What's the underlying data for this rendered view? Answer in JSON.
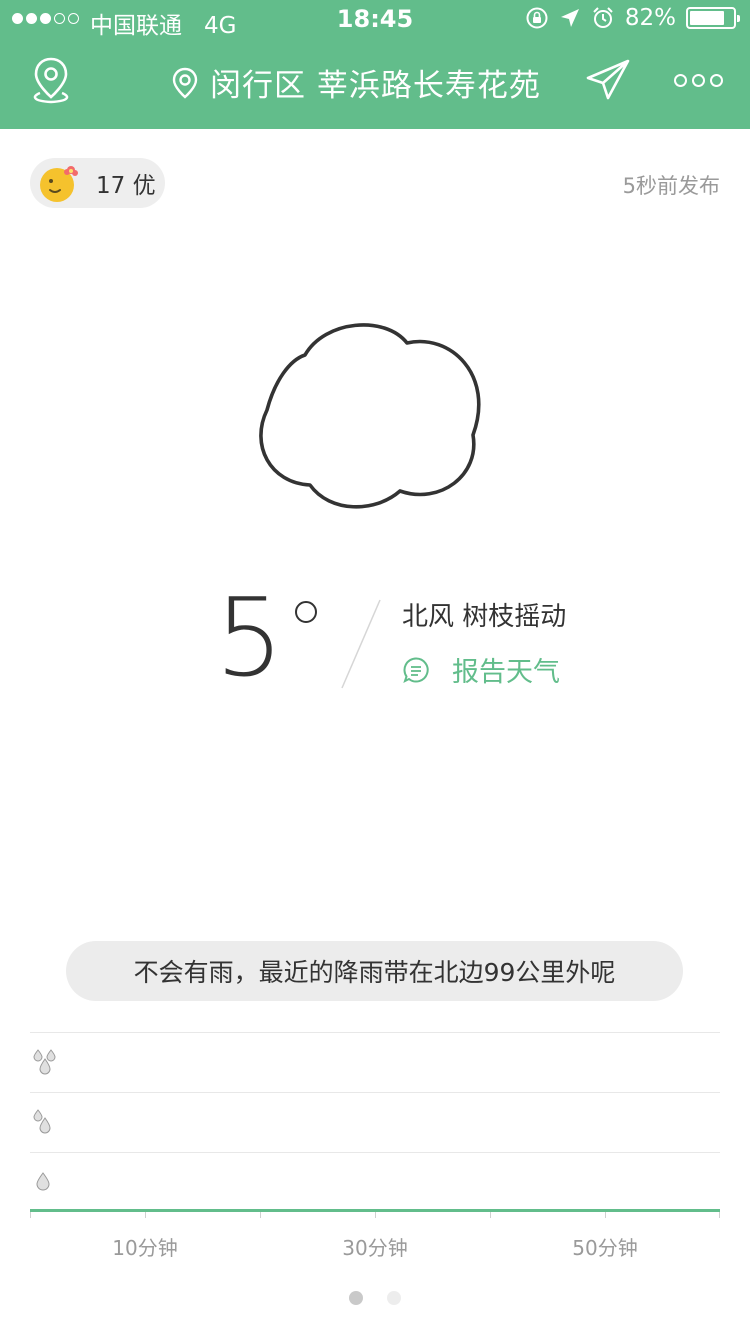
{
  "status_bar": {
    "carrier": "中国联通",
    "network": "4G",
    "time": "18:45",
    "battery_percent": "82%",
    "battery_level": 0.82,
    "signal_strength": 3,
    "signal_total": 5
  },
  "nav": {
    "location_title": "闵行区 莘浜路长寿花苑"
  },
  "aqi": {
    "label": "17 优"
  },
  "publish_time": "5秒前发布",
  "weather": {
    "temperature": "5",
    "wind": "北风 树枝摇动",
    "report_label": "报告天气",
    "icon": "cloud-icon"
  },
  "rain_message": "不会有雨，最近的降雨带在北边99公里外呢",
  "chart_data": {
    "type": "area",
    "x_ticks": [
      "10分钟",
      "30分钟",
      "50分钟"
    ],
    "y_levels": [
      "heavy-rain-icon",
      "moderate-rain-icon",
      "light-rain-icon"
    ],
    "values": [
      0,
      0,
      0,
      0,
      0,
      0,
      0
    ],
    "series_color": "#62bd8b"
  },
  "pager": {
    "active_index": 0,
    "total": 2
  },
  "colors": {
    "accent": "#62bd8b"
  }
}
